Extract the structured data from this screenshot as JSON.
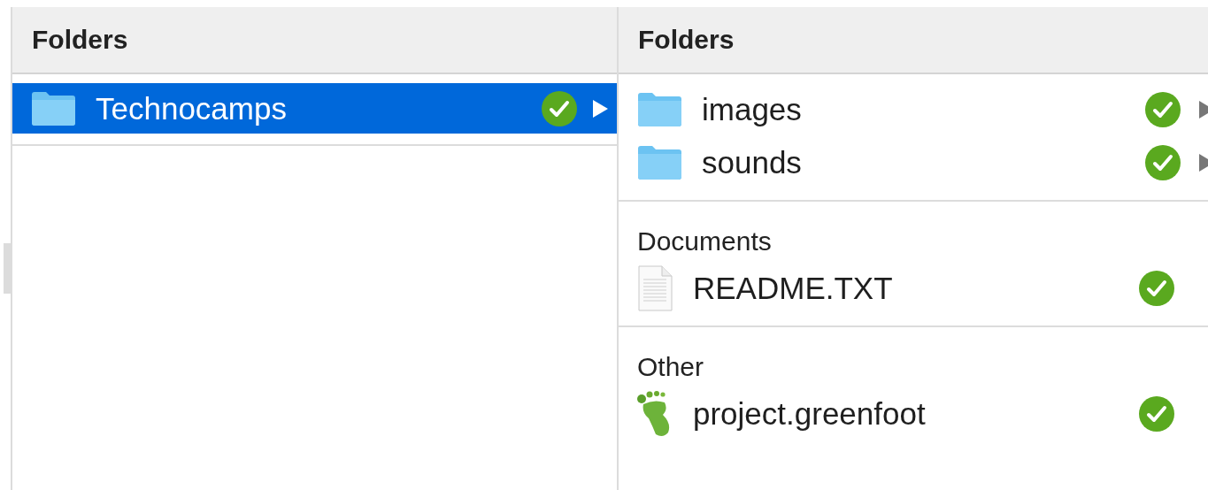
{
  "columns": [
    {
      "header": "Folders",
      "sections": [
        {
          "items": [
            {
              "name": "Technocamps",
              "kind": "folder",
              "selected": true,
              "synced": true,
              "expandable": true
            }
          ]
        }
      ]
    },
    {
      "header": "Folders",
      "sections": [
        {
          "items": [
            {
              "name": "images",
              "kind": "folder",
              "selected": false,
              "synced": true,
              "expandable": true
            },
            {
              "name": "sounds",
              "kind": "folder",
              "selected": false,
              "synced": true,
              "expandable": true
            }
          ]
        },
        {
          "title": "Documents",
          "items": [
            {
              "name": "README.TXT",
              "kind": "document",
              "selected": false,
              "synced": true,
              "expandable": false
            }
          ]
        },
        {
          "title": "Other",
          "items": [
            {
              "name": "project.greenfoot",
              "kind": "greenfoot",
              "selected": false,
              "synced": true,
              "expandable": false
            }
          ]
        }
      ]
    }
  ]
}
